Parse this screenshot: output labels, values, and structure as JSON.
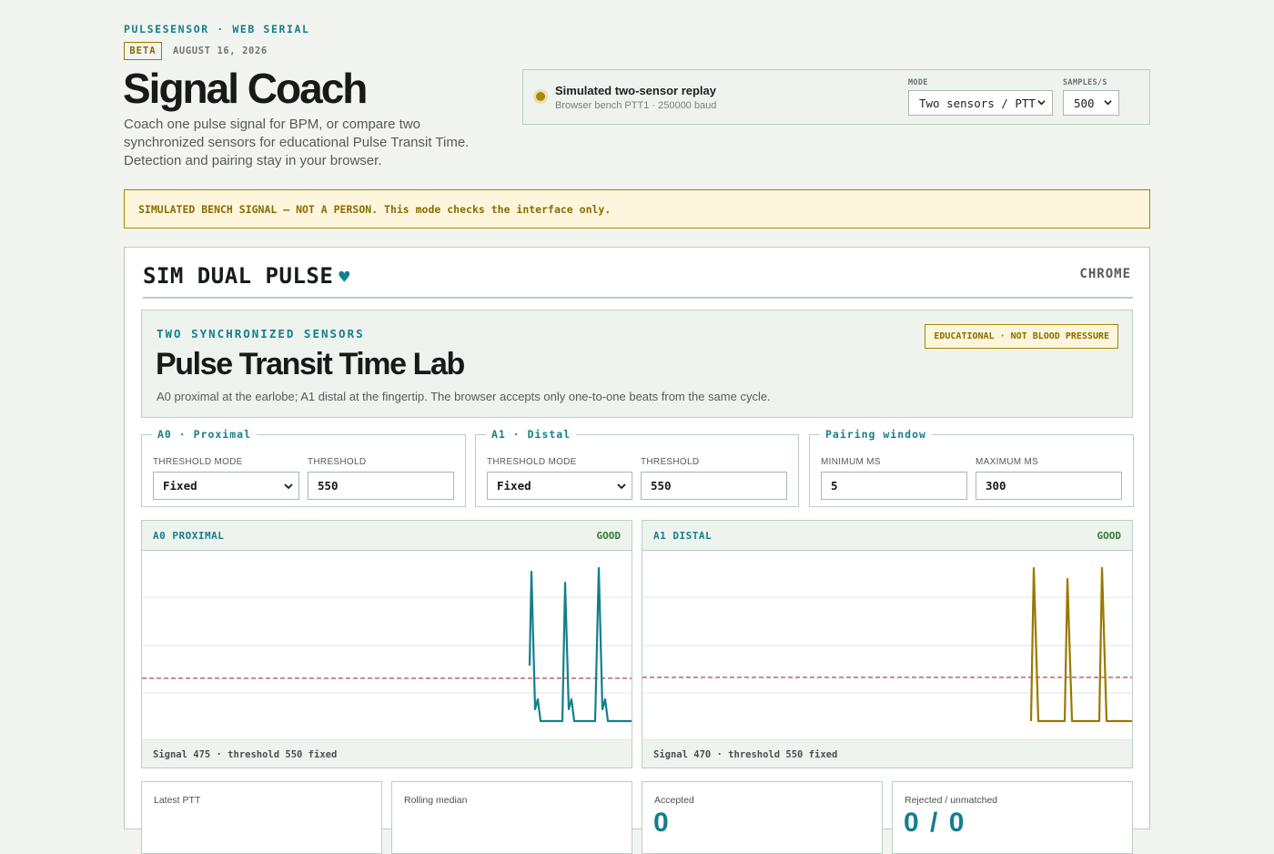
{
  "header": {
    "eyebrow": "PULSESENSOR · WEB SERIAL",
    "badge": "BETA",
    "date": "AUGUST 16, 2026",
    "title": "Signal Coach",
    "subtitle": "Coach one pulse signal for BPM, or compare two synchronized sensors for educational Pulse Transit Time. Detection and pairing stay in your browser."
  },
  "device": {
    "status_color": "#a98a06",
    "title": "Simulated two-sensor replay",
    "subtitle": "Browser bench PTT1 · 250000 baud",
    "mode_label": "MODE",
    "mode_value": "Two sensors / PTT",
    "rate_label": "SAMPLES/S",
    "rate_value": "500"
  },
  "banner": "SIMULATED BENCH SIGNAL — NOT A PERSON. This mode checks the interface only.",
  "card": {
    "title": "SIM DUAL PULSE",
    "heart_icon": "heart-icon",
    "browser": "CHROME",
    "lab": {
      "eyebrow": "TWO SYNCHRONIZED SENSORS",
      "title": "Pulse Transit Time Lab",
      "description": "A0 proximal at the earlobe; A1 distal at the fingertip. The browser accepts only one-to-one beats from the same cycle.",
      "badge": "EDUCATIONAL · NOT BLOOD PRESSURE"
    },
    "fieldsets": [
      {
        "legend": "A0 · Proximal",
        "label1": "THRESHOLD MODE",
        "value1": "Fixed",
        "label2": "THRESHOLD",
        "value2": "550"
      },
      {
        "legend": "A1 · Distal",
        "label1": "THRESHOLD MODE",
        "value1": "Fixed",
        "label2": "THRESHOLD",
        "value2": "550"
      },
      {
        "legend": "Pairing window",
        "label1": "MINIMUM MS",
        "value1": "5",
        "label2": "MAXIMUM MS",
        "value2": "300"
      }
    ],
    "charts": [
      {
        "title": "A0 PROXIMAL",
        "status": "GOOD",
        "footer": "Signal 475 · threshold 550 fixed",
        "color": "#137f8c"
      },
      {
        "title": "A1 DISTAL",
        "status": "GOOD",
        "footer": "Signal 470 · threshold 550 fixed",
        "color": "#9a7800"
      }
    ],
    "stats": [
      {
        "label": "Latest PTT",
        "value": ""
      },
      {
        "label": "Rolling median",
        "value": ""
      },
      {
        "label": "Accepted",
        "value": "0"
      },
      {
        "label": "Rejected / unmatched",
        "value": "0 / 0"
      }
    ]
  }
}
